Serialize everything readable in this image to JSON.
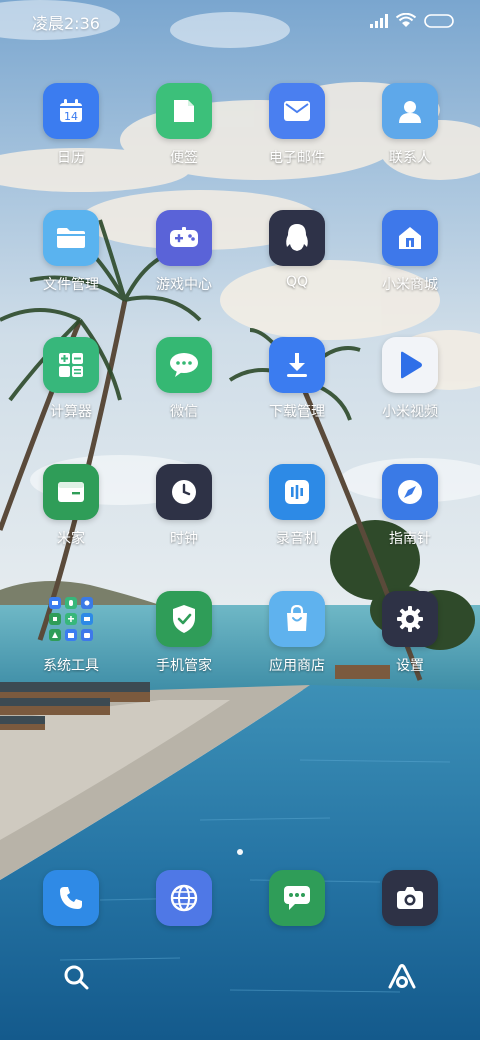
{
  "status_bar": {
    "time": "凌晨2:36"
  },
  "apps_rows": [
    [
      {
        "label": "日历",
        "icon": "calendar-icon",
        "color": "#3b7cf0"
      },
      {
        "label": "便签",
        "icon": "note-icon",
        "color": "#3cc07a"
      },
      {
        "label": "电子邮件",
        "icon": "mail-icon",
        "color": "#4a7ff0"
      },
      {
        "label": "联系人",
        "icon": "contacts-icon",
        "color": "#5ea8ea"
      }
    ],
    [
      {
        "label": "文件管理",
        "icon": "folder-icon",
        "color": "#5ab3ef"
      },
      {
        "label": "游戏中心",
        "icon": "gamepad-icon",
        "color": "#5a63d8"
      },
      {
        "label": "QQ",
        "icon": "qq-penguin-icon",
        "color": "#2e3248"
      },
      {
        "label": "小米商城",
        "icon": "mi-store-icon",
        "color": "#3e78ea"
      }
    ],
    [
      {
        "label": "计算器",
        "icon": "calculator-icon",
        "color": "#37b77b"
      },
      {
        "label": "微信",
        "icon": "wechat-icon",
        "color": "#35b873"
      },
      {
        "label": "下载管理",
        "icon": "download-icon",
        "color": "#3b7cf0"
      },
      {
        "label": "小米视频",
        "icon": "play-icon",
        "color": "#f2f4f8"
      }
    ],
    [
      {
        "label": "米家",
        "icon": "mijia-icon",
        "color": "#2f9d58"
      },
      {
        "label": "时钟",
        "icon": "clock-icon",
        "color": "#2e3246"
      },
      {
        "label": "录音机",
        "icon": "recorder-icon",
        "color": "#2d8ae6"
      },
      {
        "label": "指南针",
        "icon": "compass-icon",
        "color": "#3a7ae6"
      }
    ],
    [
      {
        "label": "系统工具",
        "icon": "folder-grid-icon",
        "color": ""
      },
      {
        "label": "手机管家",
        "icon": "shield-icon",
        "color": "#2f9d58"
      },
      {
        "label": "应用商店",
        "icon": "app-store-icon",
        "color": "#5fb2ee"
      },
      {
        "label": "设置",
        "icon": "settings-gear-icon",
        "color": "#2e3246"
      }
    ]
  ],
  "dock": [
    {
      "icon": "phone-icon",
      "color": "#2f8ae6"
    },
    {
      "icon": "browser-globe-icon",
      "color": "#4f78e6"
    },
    {
      "icon": "messages-icon",
      "color": "#2f9d58"
    },
    {
      "icon": "camera-icon",
      "color": "#2e3246"
    }
  ],
  "bottom_controls": [
    {
      "icon": "search-icon"
    },
    {
      "icon": "assistant-icon"
    }
  ]
}
